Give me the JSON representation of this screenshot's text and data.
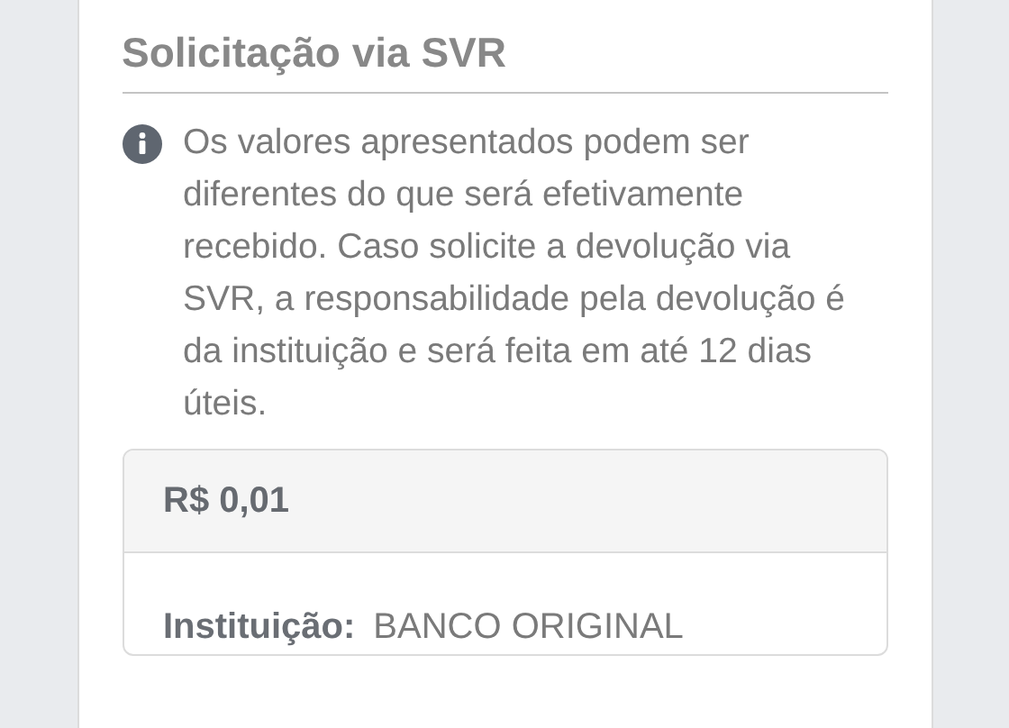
{
  "section": {
    "title": "Solicitação via SVR",
    "notice": "Os valores apresentados podem ser diferentes do que será efetivamente recebido. Caso solicite a devolução via SVR, a responsabilidade pela devolução é da instituição e será feita em até 12 dias úteis.",
    "card": {
      "amount": "R$ 0,01",
      "fields": [
        {
          "label": "Instituição:",
          "value": "BANCO ORIGINAL"
        }
      ]
    }
  }
}
